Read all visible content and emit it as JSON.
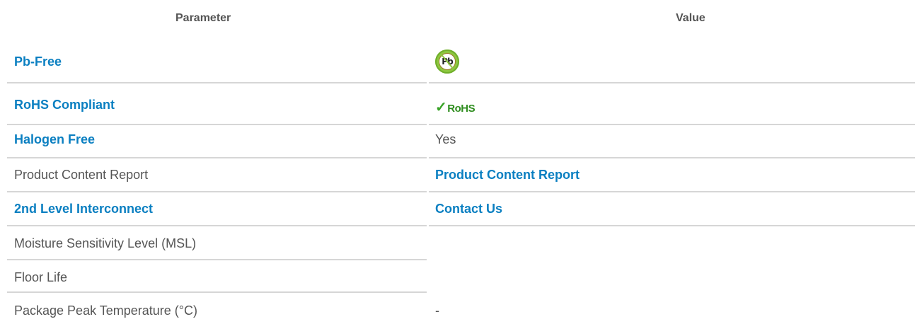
{
  "headers": {
    "parameter": "Parameter",
    "value": "Value"
  },
  "rows": [
    {
      "param": "Pb-Free",
      "value_icon": "pb-free-icon"
    },
    {
      "param": "RoHS Compliant",
      "value_icon": "rohs-compliant-icon"
    },
    {
      "param": "Halogen Free",
      "value": "Yes"
    },
    {
      "param": "Product Content Report",
      "value": "Product Content Report"
    },
    {
      "param": "2nd Level Interconnect",
      "value": "Contact Us"
    },
    {
      "param": "Moisture Sensitivity Level (MSL)",
      "value": ""
    },
    {
      "param": "Floor Life",
      "value": ""
    },
    {
      "param": "Package Peak Temperature (°C)",
      "value": "-"
    }
  ],
  "badges": {
    "pb_text": "Pb",
    "rohs_check": "✓",
    "rohs_text": "RoHS"
  },
  "colors": {
    "link": "#0a7fc1",
    "text": "#555555",
    "rule": "#d6d6d6",
    "pb_green": "#8dc63f",
    "rohs_green": "#2f8d1f"
  }
}
